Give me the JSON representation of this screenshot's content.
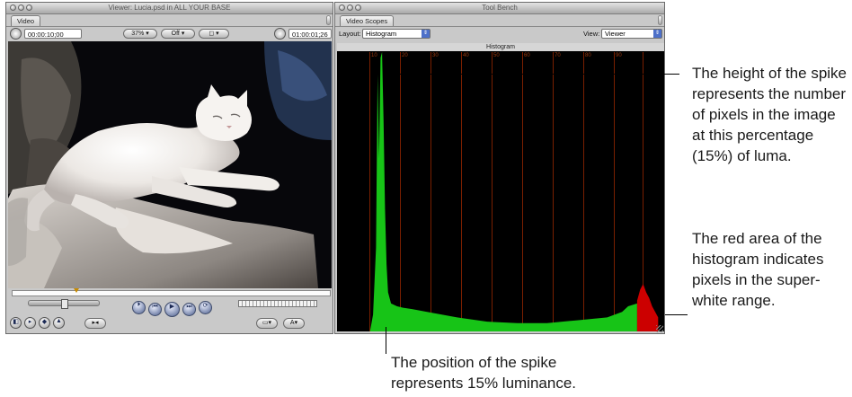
{
  "viewer": {
    "title": "Viewer: Lucia.psd in ALL YOUR BASE",
    "tab": "Video",
    "timecode_left": "00:00:10;00",
    "zoom": "37%",
    "overlay": "Off",
    "timecode_right": "01:00:01;26"
  },
  "toolbench": {
    "title": "Tool Bench",
    "tab": "Video Scopes",
    "layout_label": "Layout:",
    "layout_value": "Histogram",
    "view_label": "View:",
    "view_value": "Viewer",
    "scope_title": "Histogram",
    "ticks": [
      "10",
      "20",
      "30",
      "40",
      "50",
      "60",
      "70",
      "80",
      "90"
    ],
    "colors": {
      "green": "#17c417",
      "red": "#cc0000",
      "grid": "#7a1f00"
    }
  },
  "chart_data": {
    "type": "area",
    "title": "Histogram",
    "xlabel": "",
    "ylabel": "",
    "xlim": [
      0,
      109
    ],
    "ylim": [
      0,
      1
    ],
    "x_ticks": [
      10,
      20,
      30,
      40,
      50,
      60,
      70,
      80,
      90
    ],
    "series": [
      {
        "color": "#17c417",
        "x": [
          0,
          11,
          12,
          13,
          13.5,
          14,
          14.5,
          15,
          15.5,
          16,
          16.5,
          17,
          18,
          20,
          22,
          25,
          30,
          40,
          50,
          60,
          70,
          80,
          90,
          95,
          97,
          100
        ],
        "values": [
          0,
          0,
          0.06,
          0.3,
          0.92,
          0.62,
          0.98,
          1.0,
          0.75,
          0.44,
          0.24,
          0.14,
          0.1,
          0.09,
          0.085,
          0.08,
          0.07,
          0.05,
          0.035,
          0.03,
          0.03,
          0.04,
          0.05,
          0.07,
          0.09,
          0.1
        ]
      },
      {
        "color": "#cc0000",
        "x": [
          100,
          101,
          102,
          103,
          104,
          105,
          106,
          107
        ],
        "values": [
          0.11,
          0.15,
          0.17,
          0.14,
          0.12,
          0.09,
          0.07,
          0.05
        ]
      }
    ]
  },
  "callouts": {
    "height": "The height of the spike represents the number of pixels in the image at this percentage (15%) of luma.",
    "red_area": "The red area of the histogram indicates pixels in the super-white range.",
    "position": "The position of the spike represents 15% luminance."
  }
}
